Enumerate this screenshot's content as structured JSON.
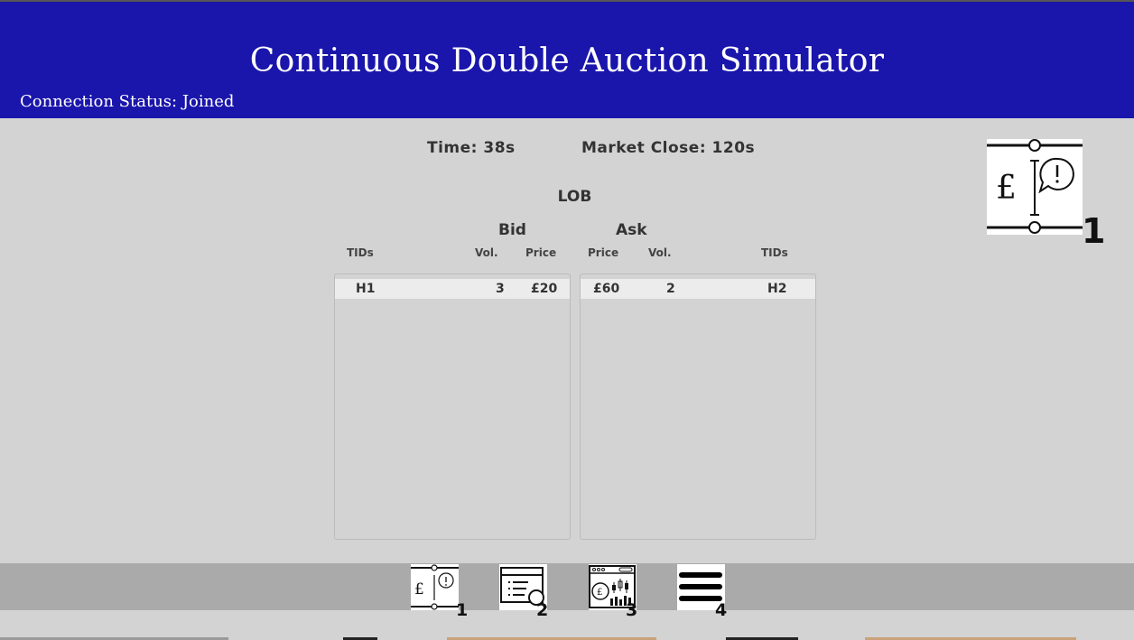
{
  "header": {
    "title": "Continuous Double Auction Simulator",
    "connection_status": "Connection Status: Joined"
  },
  "market": {
    "time": "Time: 38s",
    "close": "Market Close: 120s"
  },
  "lob": {
    "title": "LOB",
    "bid": {
      "label": "Bid",
      "columns": {
        "tids": "TIDs",
        "vol": "Vol.",
        "price": "Price"
      },
      "rows": [
        {
          "tid": "H1",
          "vol": "3",
          "price": "£20"
        }
      ]
    },
    "ask": {
      "label": "Ask",
      "columns": {
        "price": "Price",
        "vol": "Vol.",
        "tids": "TIDs"
      },
      "rows": [
        {
          "price": "£60",
          "vol": "2",
          "tid": "H2"
        }
      ]
    }
  },
  "active_view": {
    "number": "1",
    "icon": "pound-alert-icon"
  },
  "toolbar": {
    "buttons": [
      {
        "number": "1",
        "icon": "pound-alert-icon"
      },
      {
        "number": "2",
        "icon": "list-search-icon"
      },
      {
        "number": "3",
        "icon": "chart-dashboard-icon"
      },
      {
        "number": "4",
        "icon": "menu-icon"
      }
    ]
  },
  "colors": {
    "header": "#1a15ab",
    "background": "#d3d3d3",
    "toolbar": "#aaaaaa"
  }
}
